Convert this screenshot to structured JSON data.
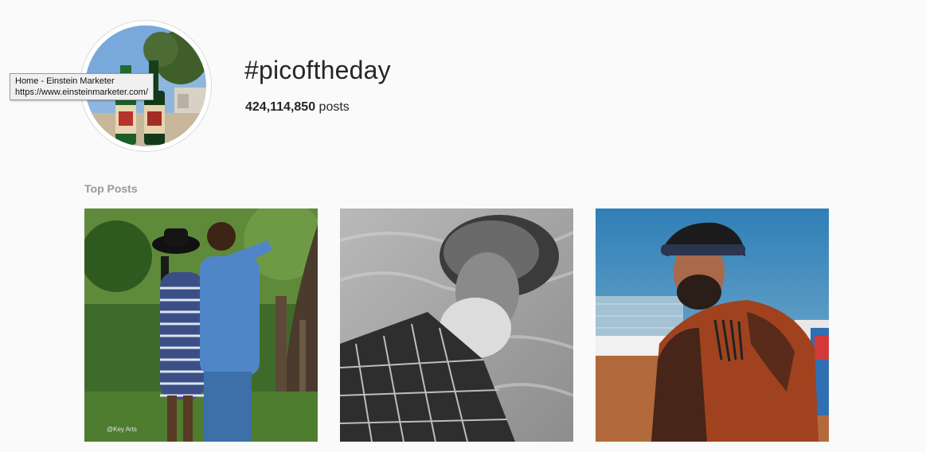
{
  "tooltip": {
    "title": "Home - Einstein Marketer",
    "url": "https://www.einsteinmarketer.com/"
  },
  "hashtag": {
    "title": "#picoftheday",
    "post_count": "424,114,850",
    "post_count_suffix": " posts"
  },
  "top_posts": {
    "label": "Top Posts",
    "items": [
      {
        "subject": "couple-in-field",
        "watermark": "@Key Arts"
      },
      {
        "subject": "bearded-elder-bw"
      },
      {
        "subject": "tattooed-man-beach"
      }
    ]
  },
  "colors": {
    "background": "#fafafa",
    "text": "#262626",
    "muted": "#999999"
  }
}
